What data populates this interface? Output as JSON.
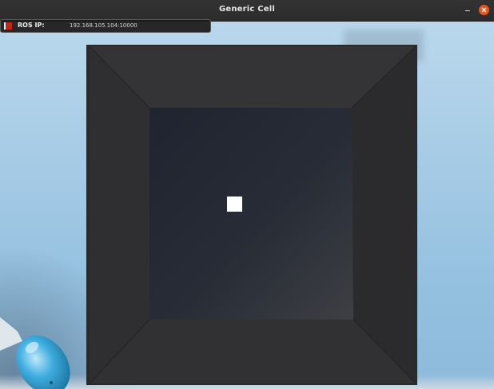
{
  "window": {
    "title": "Generic Cell",
    "controls": {
      "minimize_icon": "minimize-icon",
      "close_icon": "close-icon",
      "close_color": "#e9541f"
    }
  },
  "ros_panel": {
    "label": "ROS IP:",
    "ip_value": "192.168.105.104:10000",
    "status_icon": "connection-status-indicator",
    "status_color": "#c0271a"
  },
  "scene": {
    "sky_color": "#a8cce6",
    "box_color": "#2e2e30",
    "inner_floor_color": "#252a33",
    "marker_color": "#ffffff",
    "robot_color": "#3aa6d6"
  }
}
